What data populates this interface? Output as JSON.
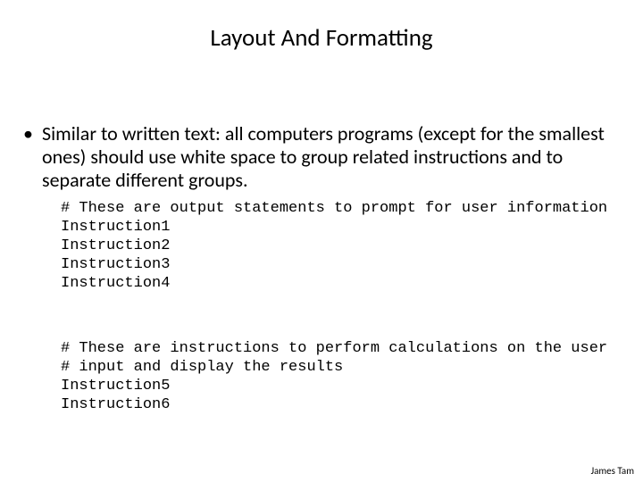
{
  "title": "Layout And Formatting",
  "bullet": {
    "dot": "•",
    "text": "Similar to written text: all computers programs (except for the smallest ones) should use white space to group related instructions and to separate different groups."
  },
  "code1": "# These are output statements to prompt for user information\nInstruction1\nInstruction2\nInstruction3\nInstruction4",
  "code2": "# These are instructions to perform calculations on the user\n# input and display the results\nInstruction5\nInstruction6",
  "footer": "James Tam"
}
